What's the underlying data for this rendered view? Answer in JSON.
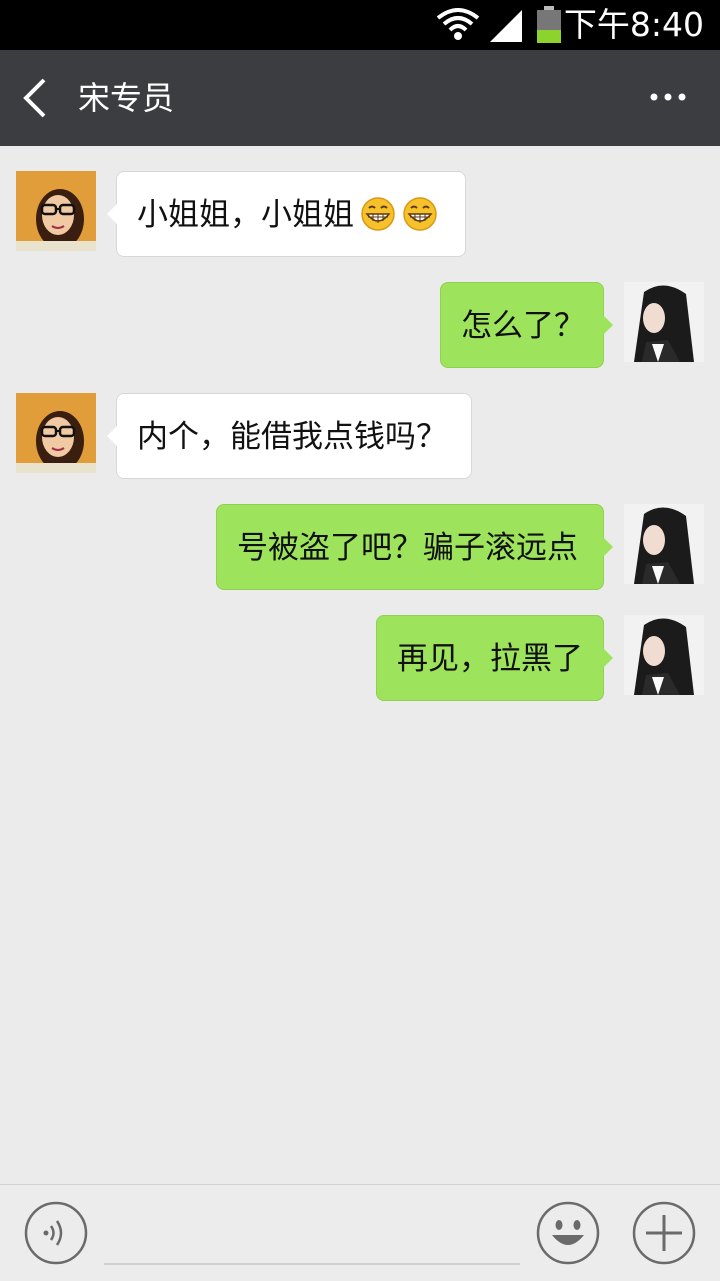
{
  "status_bar": {
    "time": "下午8:40"
  },
  "header": {
    "title": "宋专员"
  },
  "messages": [
    {
      "side": "left",
      "text": "小姐姐，小姐姐",
      "emoji": "grin-emoji x2"
    },
    {
      "side": "right",
      "text": "怎么了？"
    },
    {
      "side": "left",
      "text": "内个，能借我点钱吗？"
    },
    {
      "side": "right",
      "text": "号被盗了吧？骗子滚远点"
    },
    {
      "side": "right",
      "text": "再见，拉黑了"
    }
  ],
  "colors": {
    "title_bar": "#3c3d41",
    "chat_bg": "#ebebeb",
    "sent_bubble": "#9ee35c",
    "received_bubble": "#ffffff"
  },
  "icons": [
    "back-arrow-icon",
    "more-icon",
    "voice-icon",
    "emoji-icon",
    "plus-icon",
    "wifi-icon",
    "signal-icon",
    "battery-icon"
  ]
}
